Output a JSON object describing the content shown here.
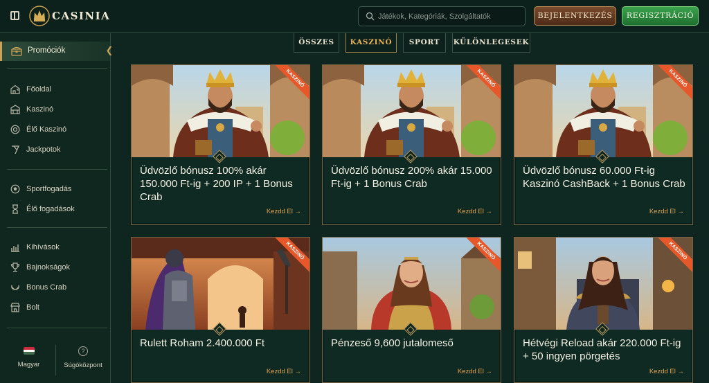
{
  "brand": {
    "name": "CASINIA"
  },
  "search": {
    "placeholder": "Játékok, Kategóriák, Szolgáltatók"
  },
  "header": {
    "login_label": "BEJELENTKEZÉS",
    "register_label": "REGISZTRÁCIÓ"
  },
  "colors": {
    "accent": "#e3a24f",
    "register": "#2f8c3e",
    "ribbon": "#e6582a",
    "background": "#0f2520"
  },
  "sidebar": {
    "promo": {
      "label": "Promóciók",
      "icon": "chest-icon"
    },
    "group1": [
      {
        "label": "Főoldal",
        "icon": "home-icon"
      },
      {
        "label": "Kaszinó",
        "icon": "casino-icon"
      },
      {
        "label": "Élő Kaszinó",
        "icon": "live-casino-icon"
      },
      {
        "label": "Jackpotok",
        "icon": "jackpot-icon"
      }
    ],
    "group2": [
      {
        "label": "Sportfogadás",
        "icon": "soccer-ball-icon"
      },
      {
        "label": "Élő fogadások",
        "icon": "live-betting-icon"
      }
    ],
    "group3": [
      {
        "label": "Kihívások",
        "icon": "challenges-icon"
      },
      {
        "label": "Bajnokságok",
        "icon": "trophy-icon"
      },
      {
        "label": "Bonus Crab",
        "icon": "crab-icon"
      },
      {
        "label": "Bolt",
        "icon": "shop-icon"
      }
    ],
    "footer": {
      "language": "Magyar",
      "help": "Súgóközpont",
      "help_glyph": "?"
    }
  },
  "tabs": [
    {
      "label": "ÖSSZES",
      "active": false
    },
    {
      "label": "KASZINÓ",
      "active": true
    },
    {
      "label": "SPORT",
      "active": false
    },
    {
      "label": "KÜLÖNLEGESEK",
      "active": false
    }
  ],
  "cards": [
    {
      "title": "Üdvözlő bónusz 100% akár 150.000 Ft-ig + 200 IP + 1 Bonus Crab",
      "cta": "Kezdd El →",
      "ribbon": "KASZINÓ",
      "image": "king"
    },
    {
      "title": "Üdvözlő bónusz 200% akár 15.000 Ft-ig + 1 Bonus Crab",
      "cta": "Kezdd El →",
      "ribbon": "KASZINÓ",
      "image": "king"
    },
    {
      "title": "Üdvözlő bónusz 60.000 Ft-ig Kaszinó CashBack + 1 Bonus Crab",
      "cta": "Kezdd El →",
      "ribbon": "KASZINÓ",
      "image": "king"
    },
    {
      "title": "Rulett Roham 2.400.000 Ft",
      "cta": "Kezdd El →",
      "ribbon": "KASZINÓ",
      "image": "knight"
    },
    {
      "title": "Pénzeső 9,600 jutalomeső",
      "cta": "Kezdd El →",
      "ribbon": "KASZINÓ",
      "image": "warrior-woman"
    },
    {
      "title": "Hétvégi Reload akár 220.000 Ft-ig + 50 ingyen pörgetés",
      "cta": "Kezdd El →",
      "ribbon": "KASZINÓ",
      "image": "rogue-woman"
    }
  ]
}
